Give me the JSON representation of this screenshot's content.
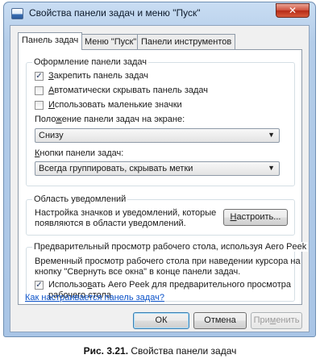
{
  "window": {
    "title": "Свойства панели задач и меню \"Пуск\"",
    "close_glyph": "✕"
  },
  "tabs": [
    {
      "label": "Панель задач",
      "active": true
    },
    {
      "label": "Меню \"Пуск\"",
      "active": false
    },
    {
      "label": "Панели инструментов",
      "active": false
    }
  ],
  "appearance": {
    "title": "Оформление панели задач",
    "lock": {
      "pre": "",
      "key": "З",
      "post": "акрепить панель задач",
      "checked": true
    },
    "autohide": {
      "pre": "",
      "key": "А",
      "post": "втоматически скрывать панель задач",
      "checked": false
    },
    "small_icons": {
      "pre": "",
      "key": "И",
      "post": "спользовать маленькие значки",
      "checked": false
    },
    "position_label": {
      "pre": "Поло",
      "key": "ж",
      "post": "ение панели задач на экране:"
    },
    "position_value": "Снизу",
    "buttons_label": {
      "pre": "",
      "key": "К",
      "post": "нопки панели задач:"
    },
    "buttons_value": "Всегда группировать, скрывать метки"
  },
  "notifications": {
    "title": "Область уведомлений",
    "line1": "Настройка значков и уведомлений, которые",
    "line2": "появляются в области уведомлений.",
    "button": {
      "pre": "",
      "key": "Н",
      "post": "астроить..."
    }
  },
  "peek": {
    "title": "Предварительный просмотр рабочего стола, используя Aero Peek",
    "line1": "Временный просмотр рабочего стола при наведении курсора на",
    "line2": "кнопку \"Свернуть все окна\" в конце панели задач.",
    "checkbox_line1": {
      "pre": "Использо",
      "key": "в",
      "post": "ать Aero Peek для предварительного просмотра"
    },
    "checkbox_line2": "рабочего стола",
    "checked": true
  },
  "help_link": "Как настраивается панель задач?",
  "buttons": {
    "ok": "ОК",
    "cancel": "Отмена",
    "apply": {
      "pre": "При",
      "key": "м",
      "post": "енить"
    }
  },
  "check_glyph": "✓",
  "arrow_glyph": "▼",
  "caption": {
    "number": "Рис. 3.21.",
    "text": " Свойства панели задач"
  }
}
